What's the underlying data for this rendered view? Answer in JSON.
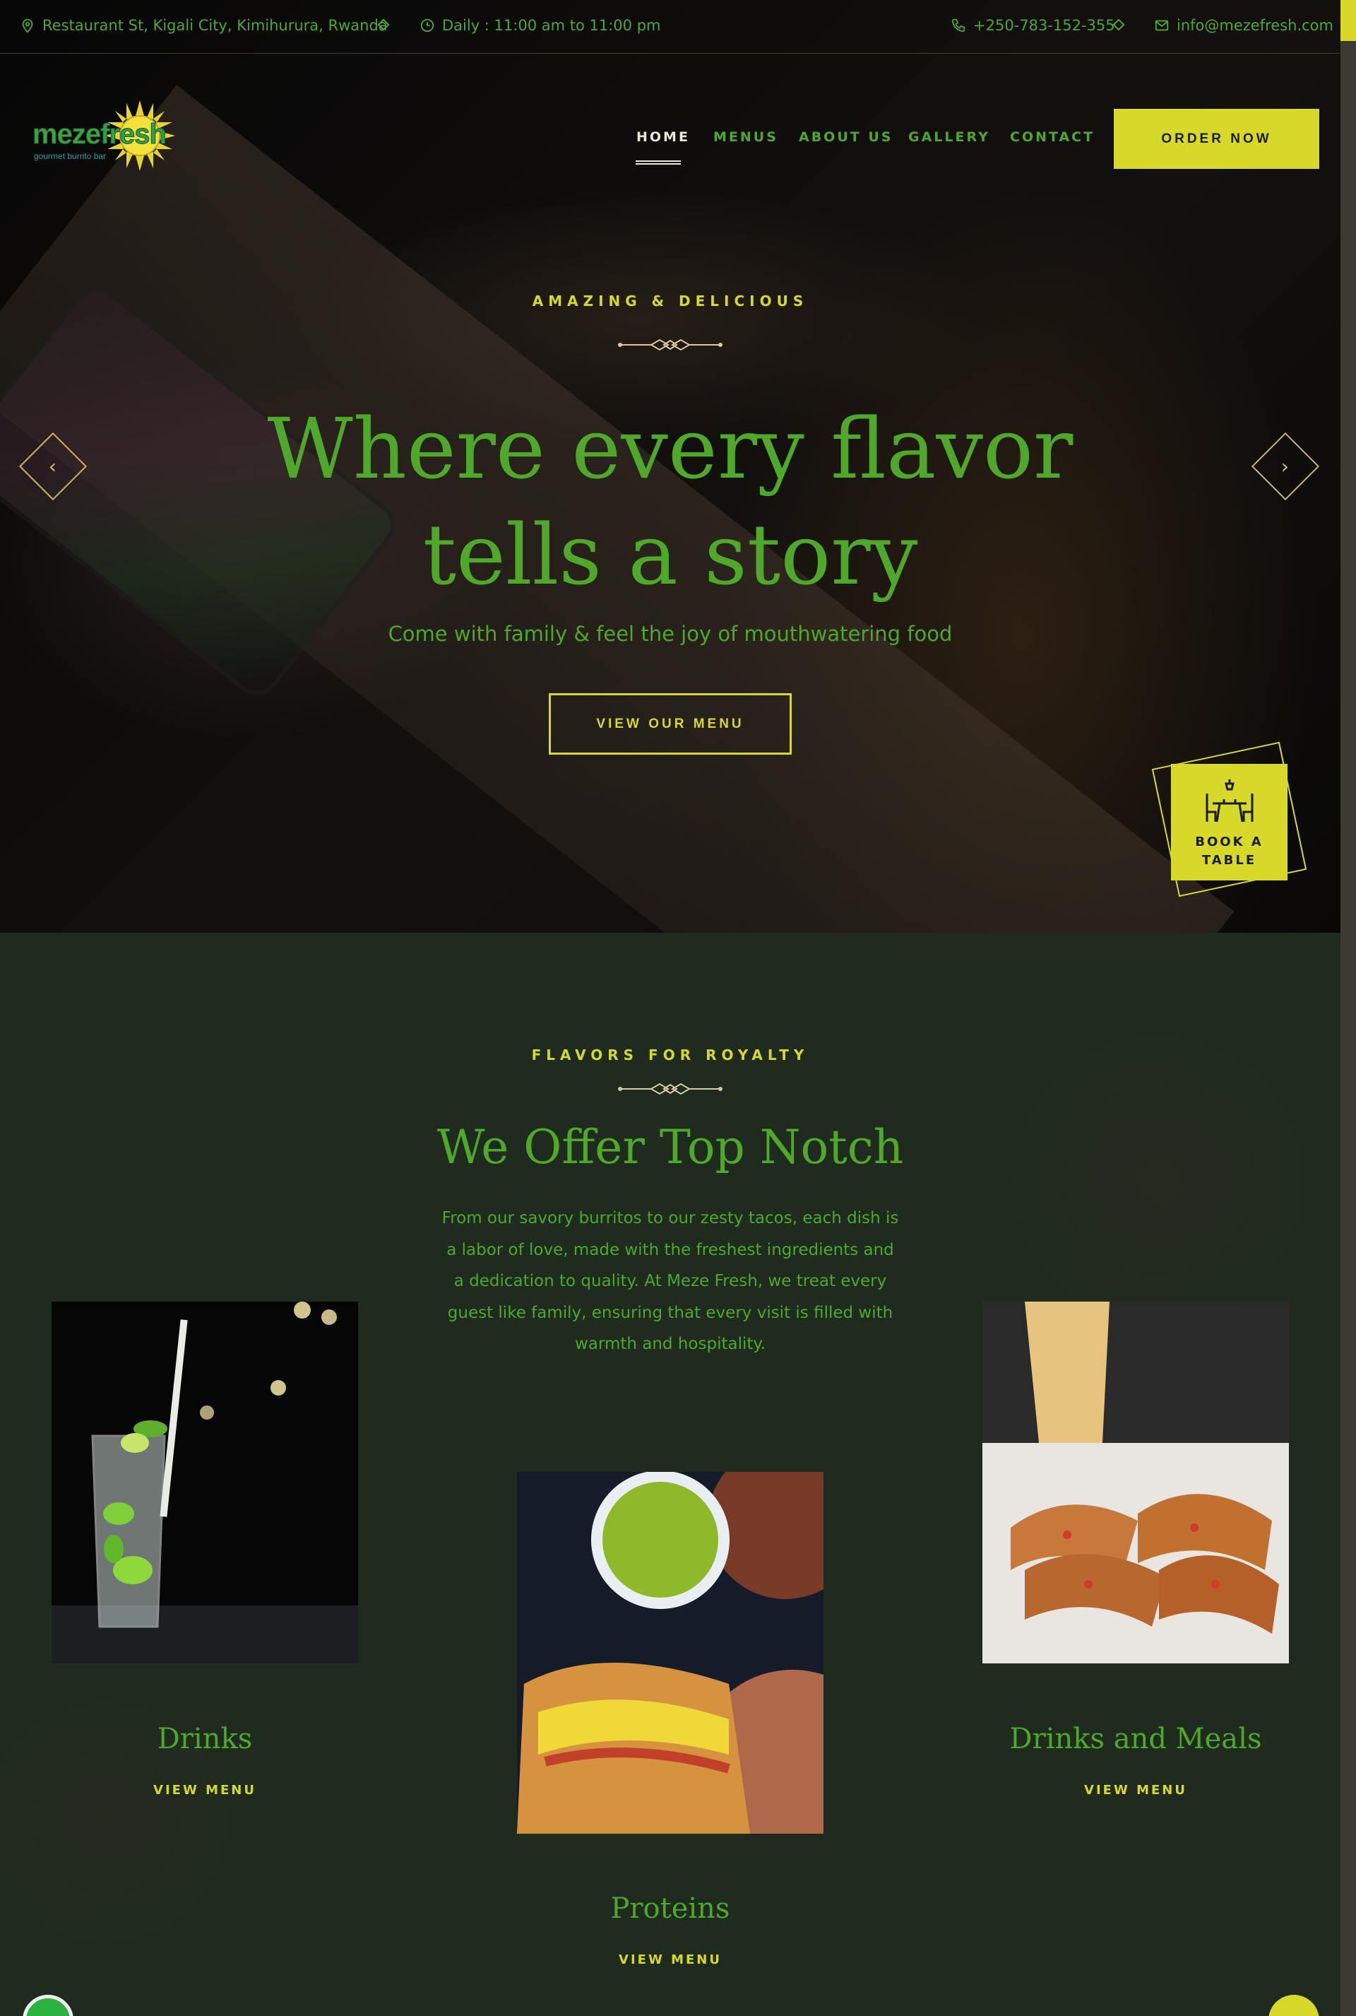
{
  "topbar": {
    "address": "Restaurant St, Kigali City, Kimihurura, Rwanda",
    "hours": "Daily : 11:00 am to 11:00 pm",
    "phone": "+250-783-152-355",
    "email": "info@mezefresh.com"
  },
  "logo": {
    "brand_part1": "meze",
    "brand_part2": "fresh",
    "tagline": "gourmet burrito bar"
  },
  "nav": {
    "items": [
      "HOME",
      "MENUS",
      "ABOUT US",
      "GALLERY",
      "CONTACT"
    ],
    "active": "HOME",
    "order_button": "ORDER NOW"
  },
  "hero": {
    "eyebrow": "AMAZING & DELICIOUS",
    "title_line1": "Where every flavor",
    "title_line2": "tells a story",
    "subtitle": "Come with family & feel the joy of mouthwatering food",
    "cta": "VIEW OUR MENU",
    "prev_icon": "chevron-left-icon",
    "next_icon": "chevron-right-icon",
    "book_table_line1": "BOOK A",
    "book_table_line2": "TABLE"
  },
  "offer": {
    "eyebrow": "FLAVORS FOR ROYALTY",
    "title": "We Offer Top Notch",
    "description": "From our savory burritos to our zesty tacos, each dish is a labor of love, made with the freshest ingredients and a dedication to quality. At Meze Fresh, we treat every guest like family, ensuring that every visit is filled with warmth and hospitality.",
    "cards": [
      {
        "title": "Drinks",
        "link": "VIEW MENU"
      },
      {
        "title": "Proteins",
        "link": "VIEW MENU"
      },
      {
        "title": "Drinks and Meals",
        "link": "VIEW MENU"
      }
    ]
  },
  "colors": {
    "accent_yellow": "#d6d92a",
    "brand_green": "#4fa82a",
    "section_bg": "#1f2b1f"
  }
}
